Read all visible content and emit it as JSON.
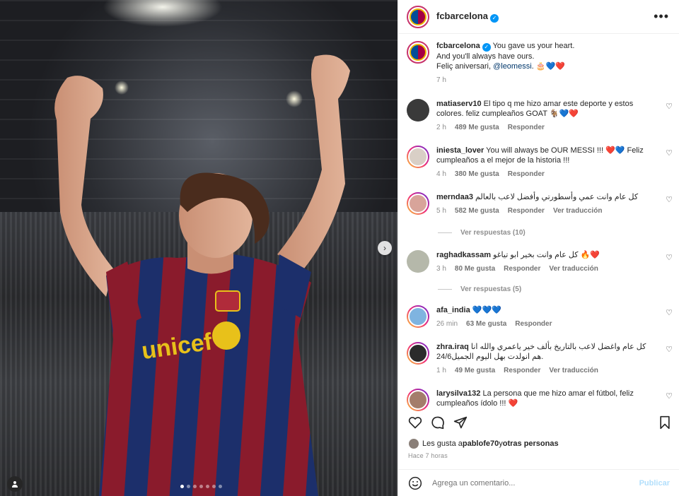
{
  "post": {
    "account": "fcbarcelona",
    "slide_count": 7,
    "active_slide": 1
  },
  "caption": {
    "username": "fcbarcelona",
    "line1": "You gave us your heart.",
    "line2": "And you'll always have ours.",
    "line3_prefix": "Feliç aniversari, ",
    "mention": "@leomessi",
    "line3_suffix": ". 🎂💙❤️",
    "time": "7 h"
  },
  "comments": [
    {
      "user": "matiaserv10",
      "text": "El tipo q me hizo amar este deporte y estos colores. feliz cumpleaños GOAT 🐐💙❤️",
      "time": "2 h",
      "likes": "489 Me gusta",
      "reply": "Responder",
      "translate": ""
    },
    {
      "user": "iniesta_lover",
      "text": "You will always be OUR MESSI !!! ❤️💙 Feliz cumpleaños a el mejor de la historia !!!",
      "time": "4 h",
      "likes": "380 Me gusta",
      "reply": "Responder",
      "translate": ""
    },
    {
      "user": "merndaa3",
      "text": "كل عام وانت عمي وأسطورتي وأفضل لاعب بالعالم",
      "time": "5 h",
      "likes": "582 Me gusta",
      "reply": "Responder",
      "translate": "Ver traducción"
    },
    {
      "user": "raghadkassam",
      "text": "كل عام وانت بخير ابو تياغو 🔥❤️",
      "time": "3 h",
      "likes": "80 Me gusta",
      "reply": "Responder",
      "translate": "Ver traducción"
    },
    {
      "user": "afa_india",
      "text": "💙💙💙",
      "time": "26 min",
      "likes": "63 Me gusta",
      "reply": "Responder",
      "translate": ""
    },
    {
      "user": "zhra.iraq",
      "text": "كل عام واغضل لاعب بالتاريخ بألف خير ياعمري والله انا هم انولدت بهل اليوم الجميل24/6.",
      "time": "1 h",
      "likes": "49 Me gusta",
      "reply": "Responder",
      "translate": "Ver traducción"
    },
    {
      "user": "larysilva132",
      "text": "La persona que me hizo amar el fútbol, feliz cumpleaños ídolo !!! ❤️",
      "time": "",
      "likes": "",
      "reply": "",
      "translate": ""
    }
  ],
  "view_replies": [
    "Ver respuestas (10)",
    "Ver respuestas (5)"
  ],
  "liked_by": {
    "prefix": "Les gusta a ",
    "user": "pablofe70",
    "middle": " y ",
    "others": "otras personas"
  },
  "posted": "Hace 7 horas",
  "add_comment": {
    "placeholder": "Agrega un comentario...",
    "publish": "Publicar"
  },
  "icons": {
    "like": "heart-icon",
    "comment": "comment-icon",
    "share": "share-icon",
    "save": "bookmark-icon",
    "emoji": "emoji-icon",
    "more": "more-options-icon",
    "next": "chevron-right-icon",
    "tag": "user-tag-icon"
  },
  "colors": {
    "verified": "#0095f6",
    "link": "#00376b",
    "publish_disabled": "#b2dffc"
  }
}
